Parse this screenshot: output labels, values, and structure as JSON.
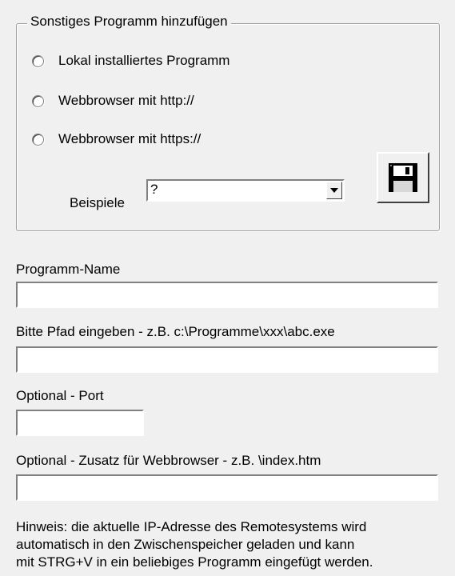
{
  "group": {
    "title": "Sonstiges Programm hinzufügen",
    "options": [
      "Lokal installiertes Programm",
      "Webbrowser mit http://",
      "Webbrowser mit https://"
    ],
    "examples_label": "Beispiele",
    "examples_value": "?",
    "save_icon": "floppy-disk-icon"
  },
  "fields": {
    "program_name_label": "Programm-Name",
    "program_name_value": "",
    "path_label": "Bitte Pfad eingeben - z.B. c:\\Programme\\xxx\\abc.exe",
    "path_value": "",
    "port_label": "Optional - Port",
    "port_value": "",
    "suffix_label": "Optional - Zusatz für Webbrowser - z.B. \\index.htm",
    "suffix_value": ""
  },
  "hint": {
    "line1": "Hinweis: die aktuelle IP-Adresse des Remotesystems wird",
    "line2": "automatisch in den Zwischenspeicher geladen und kann",
    "line3": "mit STRG+V in ein beliebiges Programm eingefügt werden."
  }
}
